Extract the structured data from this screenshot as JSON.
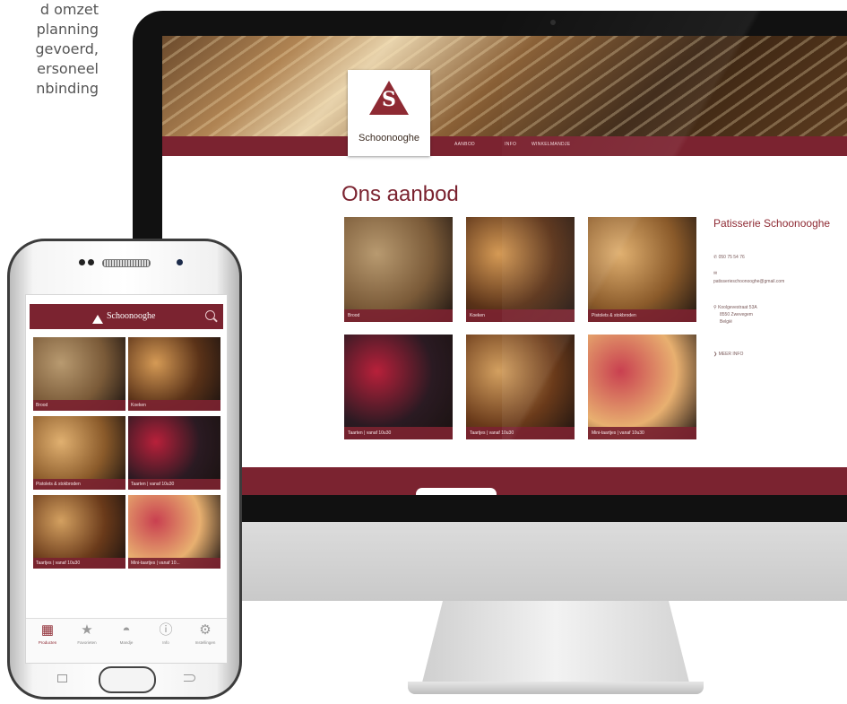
{
  "intro_lines": [
    "d omzet",
    "planning",
    "gevoerd,",
    "ersoneel",
    "nbinding"
  ],
  "desktop": {
    "logo_name": "Schoonooghe",
    "logo_letter": "S",
    "nav": [
      "AANBOD",
      "INFO",
      "WINKELMANDJE"
    ],
    "page_title": "Ons aanbod",
    "tiles": [
      {
        "label": "Brood",
        "colors": [
          "#b89a70",
          "#7a5a38"
        ]
      },
      {
        "label": "Koeken",
        "colors": [
          "#d59a55",
          "#5a3218"
        ]
      },
      {
        "label": "Pistolets & stokbroden",
        "colors": [
          "#e0b070",
          "#8a5a2a"
        ]
      },
      {
        "label": "Taarten | vanaf 10u30",
        "colors": [
          "#b8203a",
          "#2a1a22"
        ]
      },
      {
        "label": "Taartjes | vanaf 10u30",
        "colors": [
          "#d3a060",
          "#6a3a1a"
        ]
      },
      {
        "label": "Mini-taartjes | vanaf 10u30",
        "colors": [
          "#c94050",
          "#e8b070"
        ]
      }
    ],
    "side": {
      "title": "Patisserie Schoonooghe",
      "phone": "050 75 54 76",
      "email": "patisserieschoonooghe@gmail.com",
      "address": [
        "Koolgevestraat 53A",
        "8550 Zwevegem",
        "België"
      ],
      "more": "MEER INFO"
    }
  },
  "mobile": {
    "logo_text": "Schoonooghe",
    "tiles": [
      {
        "label": "Brood",
        "colors": [
          "#b89a70",
          "#7a5a38"
        ]
      },
      {
        "label": "Koeken",
        "colors": [
          "#d59a55",
          "#5a3218"
        ]
      },
      {
        "label": "Pistolets & stokbroden",
        "colors": [
          "#e0b070",
          "#8a5a2a"
        ]
      },
      {
        "label": "Taarten | vanaf 10u30",
        "colors": [
          "#b8203a",
          "#2a1a22"
        ]
      },
      {
        "label": "Taartjes | vanaf 10u30",
        "colors": [
          "#d3a060",
          "#6a3a1a"
        ]
      },
      {
        "label": "Mini-taartjes | vanaf 10...",
        "colors": [
          "#c94050",
          "#e8b070"
        ]
      }
    ],
    "tabs": [
      {
        "label": "Producten",
        "icon": "grid-icon"
      },
      {
        "label": "Favorieten",
        "icon": "star-icon"
      },
      {
        "label": "Mandje",
        "icon": "basket-icon"
      },
      {
        "label": "Info",
        "icon": "info-icon"
      },
      {
        "label": "Instellingen",
        "icon": "gear-icon"
      }
    ]
  },
  "colors": {
    "brand": "#7b2330",
    "accent": "#8e2a33"
  }
}
